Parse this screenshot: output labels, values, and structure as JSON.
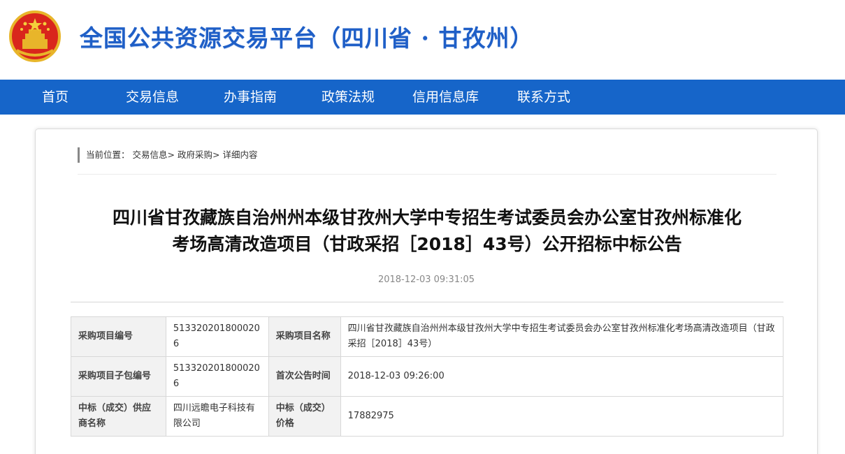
{
  "header": {
    "site_title": "全国公共资源交易平台（四川省 · 甘孜州）",
    "emblem_icon": "national-emblem-icon",
    "title_color": "#1f5fc7"
  },
  "nav": {
    "background": "#1665c9",
    "items": [
      "首页",
      "交易信息",
      "办事指南",
      "政策法规",
      "信用信息库",
      "联系方式"
    ]
  },
  "breadcrumb": {
    "prefix": "当前位置：",
    "items": [
      "交易信息>",
      "政府采购>",
      "详细内容"
    ]
  },
  "article": {
    "title_line1": "四川省甘孜藏族自治州州本级甘孜州大学中专招生考试委员会办公室甘孜州标准化",
    "title_line2": "考场高清改造项目（甘政采招［2018］43号）公开招标中标公告",
    "date": "2018-12-03 09:31:05"
  },
  "table": {
    "rows": [
      {
        "label1": "采购项目编号",
        "value1": "5133202018000206",
        "label2": "采购项目名称",
        "value2": "四川省甘孜藏族自治州州本级甘孜州大学中专招生考试委员会办公室甘孜州标准化考场高清改造项目（甘政采招［2018］43号）"
      },
      {
        "label1": "采购项目子包编号",
        "value1": "5133202018000206",
        "label2": "首次公告时间",
        "value2": "2018-12-03 09:26:00"
      },
      {
        "label1": "中标（成交）供应商名称",
        "value1": "四川远瞻电子科技有限公司",
        "label2": "中标（成交）价格",
        "value2": "17882975"
      }
    ]
  }
}
